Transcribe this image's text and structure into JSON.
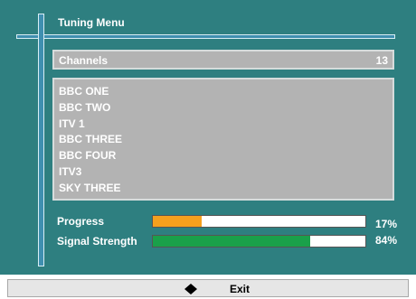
{
  "menu": {
    "title": "Tuning Menu"
  },
  "channels": {
    "label": "Channels",
    "count": "13",
    "list": [
      "BBC ONE",
      "BBC TWO",
      "ITV 1",
      "BBC THREE",
      "BBC FOUR",
      "ITV3",
      "SKY THREE"
    ]
  },
  "meters": {
    "progress": {
      "label": "Progress",
      "value_text": "17%",
      "fraction": 0.23,
      "color": "#f5a01e"
    },
    "signal": {
      "label": "Signal Strength",
      "value_text": "84%",
      "fraction": 0.74,
      "color": "#1aa04a"
    }
  },
  "footer": {
    "nav_icon": "up-down-arrow-icon",
    "exit_label": "Exit"
  },
  "colors": {
    "background": "#2e7f80",
    "panel": "#b3b3b3",
    "frame_line": "#3f8fb0"
  }
}
